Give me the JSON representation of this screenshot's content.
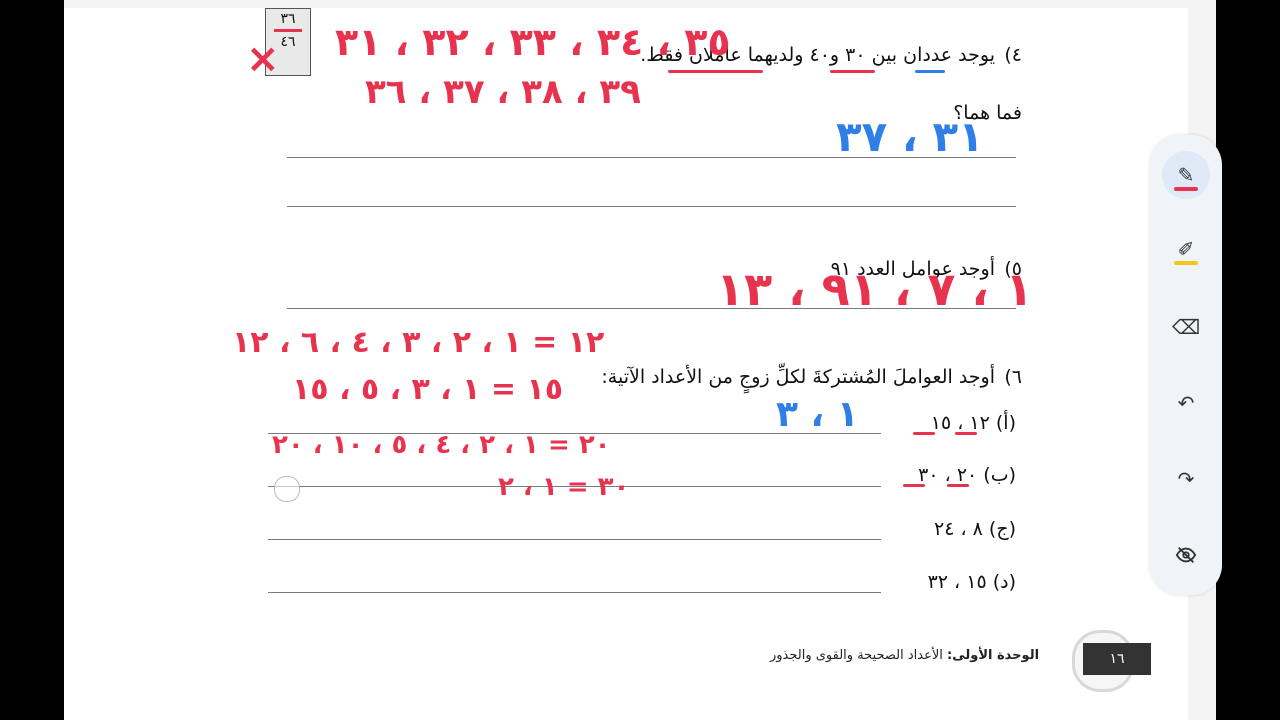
{
  "page_box": {
    "top": "٣٦",
    "bottom": "٤٦"
  },
  "questions": {
    "q4": {
      "number": "٤)",
      "text": "يوجد عددان بين ٣٠ و٤٠ ولديهما عاملان فقط.",
      "text2": "فما هما؟"
    },
    "q5": {
      "number": "٥)",
      "text": "أوجد عوامل العدد ٩١"
    },
    "q6": {
      "number": "٦)",
      "text": "أوجد العواملَ المُشتركةَ لكلِّ زوجٍ من الأعداد الآتية:",
      "items": [
        {
          "label": "(أ)",
          "value": "١٢ ، ١٥"
        },
        {
          "label": "(ب)",
          "value": "٢٠ ، ٣٠"
        },
        {
          "label": "(ج)",
          "value": "٨ ، ٢٤"
        },
        {
          "label": "(د)",
          "value": "١٥ ، ٣٢"
        }
      ]
    }
  },
  "handwriting": {
    "q4_row1": "٣٥ ، ٣٤ ، ٣٣ ، ٣٢ ، ٣١",
    "q4_row2": "٣٩ ، ٣٨ ، ٣٧ ، ٣٦",
    "q4_answer": "٣١ ، ٣٧",
    "q4_cross": "×",
    "q5_answer": "١ ، ٧ ، ٩١ ، ١٣",
    "q6_12": "١٢ = ١ ، ٢ ، ٣ ، ٤ ، ٦ ، ١٢",
    "q6_15": "١٥ = ١ ، ٣ ، ٥ ، ١٥",
    "q6_a_answer": "١ ، ٣",
    "q6_20": "٢٠ = ١ ، ٢ ، ٤ ، ٥ ، ١٠ ، ٢٠",
    "q6_30": "٣٠ = ١ ، ٢"
  },
  "footer": {
    "unit": "الوحدة الأولى:",
    "title": "الأعداد الصحيحة والقوى والجذور",
    "page": "١٦"
  },
  "toolbar": {
    "tools": [
      {
        "name": "pen-icon",
        "active": true,
        "color": "#e8334f"
      },
      {
        "name": "highlighter-icon",
        "active": false,
        "color": "#f5c518"
      },
      {
        "name": "eraser-icon",
        "active": false
      },
      {
        "name": "undo-icon",
        "active": false
      },
      {
        "name": "redo-icon",
        "active": false
      },
      {
        "name": "hide-icon",
        "active": false
      }
    ]
  },
  "colors": {
    "red_ink": "#e8334f",
    "blue_ink": "#2f7fe6"
  }
}
